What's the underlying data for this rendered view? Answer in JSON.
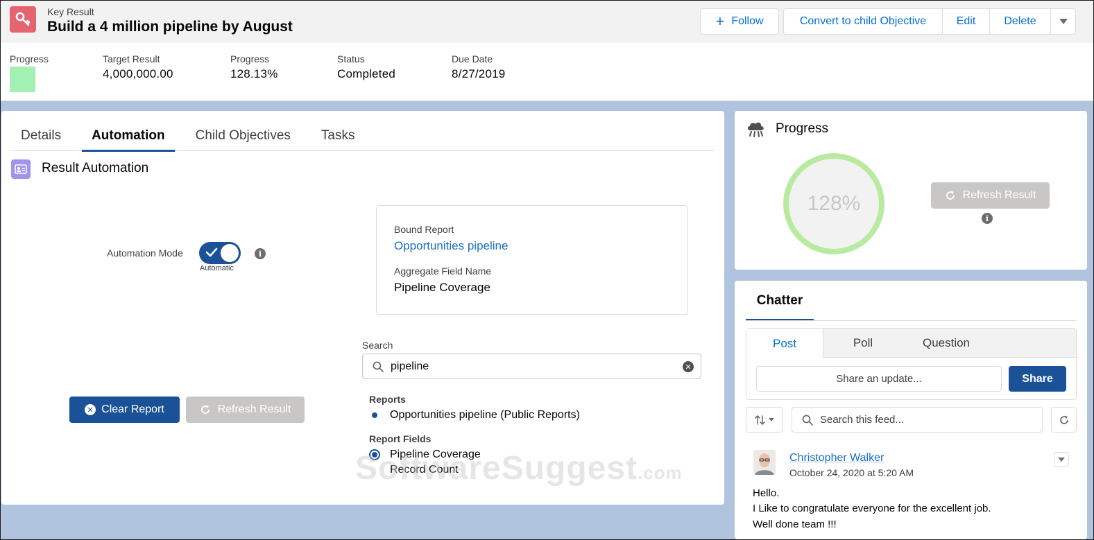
{
  "record": {
    "type_label": "Key Result",
    "title": "Build a 4 million pipeline by August"
  },
  "actions": {
    "follow": "Follow",
    "convert": "Convert to child Objective",
    "edit": "Edit",
    "delete": "Delete"
  },
  "highlights": [
    {
      "label": "Progress",
      "value": ""
    },
    {
      "label": "Target Result",
      "value": "4,000,000.00"
    },
    {
      "label": "Progress",
      "value": "128.13%"
    },
    {
      "label": "Status",
      "value": "Completed"
    },
    {
      "label": "Due Date",
      "value": "8/27/2019"
    }
  ],
  "tabs": [
    "Details",
    "Automation",
    "Child Objectives",
    "Tasks"
  ],
  "automation": {
    "section_title": "Result Automation",
    "mode_label": "Automation Mode",
    "mode_value": "Automatic",
    "bound_report_label": "Bound Report",
    "bound_report_value": "Opportunities pipeline",
    "aggregate_label": "Aggregate Field Name",
    "aggregate_value": "Pipeline Coverage",
    "search_label": "Search",
    "search_value": "pipeline",
    "reports_title": "Reports",
    "reports": [
      "Opportunities pipeline (Public Reports)"
    ],
    "fields_title": "Report Fields",
    "fields": [
      "Pipeline Coverage",
      "Record Count"
    ],
    "clear_button": "Clear Report",
    "refresh_button": "Refresh Result"
  },
  "progress_card": {
    "title": "Progress",
    "percent_text": "128%",
    "refresh_button": "Refresh Result"
  },
  "chatter": {
    "title": "Chatter",
    "tabs": [
      "Post",
      "Poll",
      "Question"
    ],
    "share_placeholder": "Share an update...",
    "share_button": "Share",
    "search_placeholder": "Search this feed...",
    "post": {
      "author": "Christopher Walker",
      "date": "October 24, 2020 at 5:20 AM",
      "lines": [
        "Hello.",
        "I Like to congratulate everyone for the excellent job.",
        "Well done team !!!"
      ]
    }
  },
  "watermark": {
    "main": "SoftwareSuggest",
    "suffix": ".com"
  },
  "colors": {
    "brand_blue": "#1b5297",
    "link_blue": "#1b6ec2",
    "key_result_icon": "#e56471",
    "section_icon": "#a094ed",
    "progress_ring": "#b8eaa0",
    "progress_swatch": "#a3f0b5",
    "background": "#b0c4df"
  },
  "icons": {
    "record": "key-result-icon",
    "section": "contact-card-icon",
    "progress": "progress-cloud-icon",
    "search": "search-icon",
    "refresh": "refresh-icon",
    "sort": "sort-icon"
  }
}
